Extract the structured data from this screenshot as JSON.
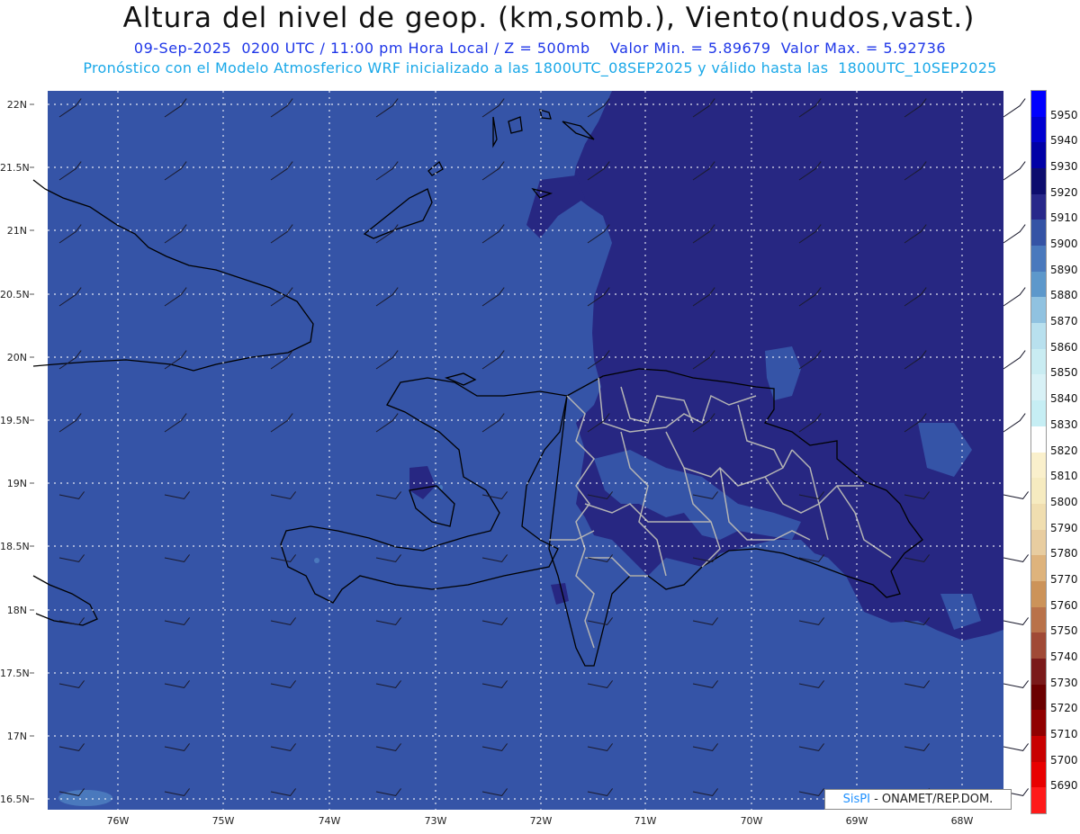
{
  "header": {
    "title": "Altura del nivel de geop. (km,somb.), Viento(nudos,vast.)",
    "subtitle": "09-Sep-2025  0200 UTC / 11:00 pm Hora Local / Z = 500mb    Valor Min. = 5.89679  Valor Max. = 5.92736",
    "init_line": "Pronóstico con el Modelo Atmosferico WRF inicializado a las 1800UTC_08SEP2025 y válido hasta las  1800UTC_10SEP2025"
  },
  "map": {
    "lat_labels": [
      "22N",
      "21.5N",
      "21N",
      "20.5N",
      "20N",
      "19.5N",
      "19N",
      "18.5N",
      "18N",
      "17.5N",
      "17N",
      "16.5N"
    ],
    "lon_labels": [
      "76W",
      "75W",
      "74W",
      "73W",
      "72W",
      "71W",
      "70W",
      "69W",
      "68W"
    ],
    "base_fill_color": "#3554a7",
    "high_fill_color": "#272782",
    "grid_style": "dotted white",
    "coastline_color": "#000000",
    "province_border_color": "#b4b4b4"
  },
  "colorbar": {
    "levels": [
      "5950",
      "5940",
      "5930",
      "5920",
      "5910",
      "5900",
      "5890",
      "5880",
      "5870",
      "5860",
      "5850",
      "5840",
      "5830",
      "5820",
      "5810",
      "5800",
      "5790",
      "5780",
      "5770",
      "5760",
      "5750",
      "5740",
      "5730",
      "5720",
      "5710",
      "5700",
      "5690"
    ],
    "colors": [
      "#0000ff",
      "#0000d0",
      "#0000a6",
      "#0d0d6e",
      "#28288a",
      "#3553a5",
      "#4a79bd",
      "#5d98cb",
      "#90c2e0",
      "#b8e0ee",
      "#c9ecf2",
      "#d8f1f6",
      "#c6eef4",
      "#ffffff",
      "#faf0cc",
      "#f6ebc0",
      "#f0deb0",
      "#e8cda0",
      "#deb37c",
      "#cc9359",
      "#b9724a",
      "#a04a36",
      "#7a1a1a",
      "#6b0000",
      "#900000",
      "#c80000",
      "#e80000",
      "#ff1a1a"
    ]
  },
  "credit": {
    "brand": "SisPI",
    "text": "- ONAMET/REP.DOM."
  }
}
